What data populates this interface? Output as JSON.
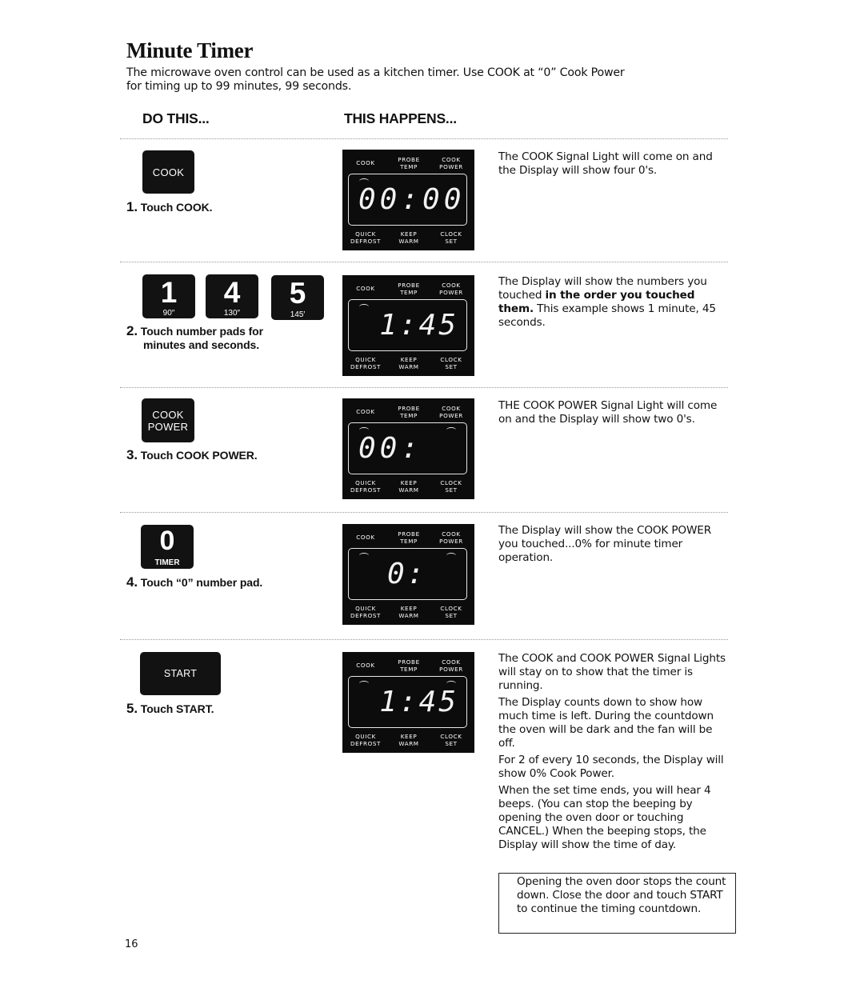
{
  "title": "Minute Timer",
  "intro": "The microwave oven control can be used as a kitchen timer. Use COOK at “0” Cook Power for timing up to 99 minutes, 99 seconds.",
  "columns": {
    "do_this": "DO THIS...",
    "this_happens": "THIS HAPPENS..."
  },
  "panel_labels": {
    "cook": "COOK",
    "probe_temp_1": "PROBE",
    "probe_temp_2": "TEMP",
    "cook_power_1": "COOK",
    "cook_power_2": "POWER",
    "quick_defrost_1": "QUICK",
    "quick_defrost_2": "DEFROST",
    "keep_warm_1": "KEEP",
    "keep_warm_2": "WARM",
    "clock_set_1": "CLOCK",
    "clock_set_2": "SET"
  },
  "steps": [
    {
      "number": "1.",
      "label": "Touch COOK.",
      "pad": {
        "label": "COOK"
      },
      "display": {
        "digits": "00:00",
        "cook_light": true,
        "power_light": false
      },
      "description": [
        "The COOK Signal Light will come on and the Display will show four 0's."
      ]
    },
    {
      "number": "2.",
      "label_line1": "Touch number pads for",
      "label_line2": "minutes and seconds.",
      "pads": [
        {
          "digit": "1",
          "sub": "90″"
        },
        {
          "digit": "4",
          "sub": "130″"
        },
        {
          "digit": "5",
          "sub": "145′"
        }
      ],
      "display": {
        "digits": "1:45",
        "cook_light": true,
        "power_light": false
      },
      "description_pre": "The Display will show the numbers you touched ",
      "description_bold": "in the order you touched them.",
      "description_post": " This example shows 1 minute, 45 seconds."
    },
    {
      "number": "3.",
      "label": "Touch COOK POWER.",
      "pad": {
        "line1": "COOK",
        "line2": "POWER"
      },
      "display": {
        "digits": "00:",
        "cook_light": true,
        "power_light": true
      },
      "description": [
        "THE COOK POWER Signal Light will come on and the Display will show two 0's."
      ]
    },
    {
      "number": "4.",
      "label": "Touch “0” number pad.",
      "pad": {
        "digit": "0",
        "sub": "TIMER"
      },
      "display": {
        "digits": "0:",
        "cook_light": true,
        "power_light": true
      },
      "description": [
        "The Display will show the COOK POWER you touched...0% for minute timer operation."
      ]
    },
    {
      "number": "5.",
      "label": "Touch START.",
      "pad": {
        "label": "START"
      },
      "display": {
        "digits": "1:45",
        "cook_light": true,
        "power_light": true
      },
      "description": [
        "The COOK and COOK POWER Signal Lights will stay on to show that the timer is running.",
        "The Display counts down to show how much time is left. During the countdown the oven will be dark and the fan will be off.",
        "For 2 of every 10 seconds, the Display will show 0% Cook Power.",
        "When the set time ends, you will hear 4 beeps. (You can stop the beeping by opening the oven door or touching CANCEL.) When the beeping stops, the Display will show the time of day."
      ]
    }
  ],
  "note": "Opening the oven door stops the count down. Close the door and touch START to continue the timing countdown.",
  "page_number": "16"
}
